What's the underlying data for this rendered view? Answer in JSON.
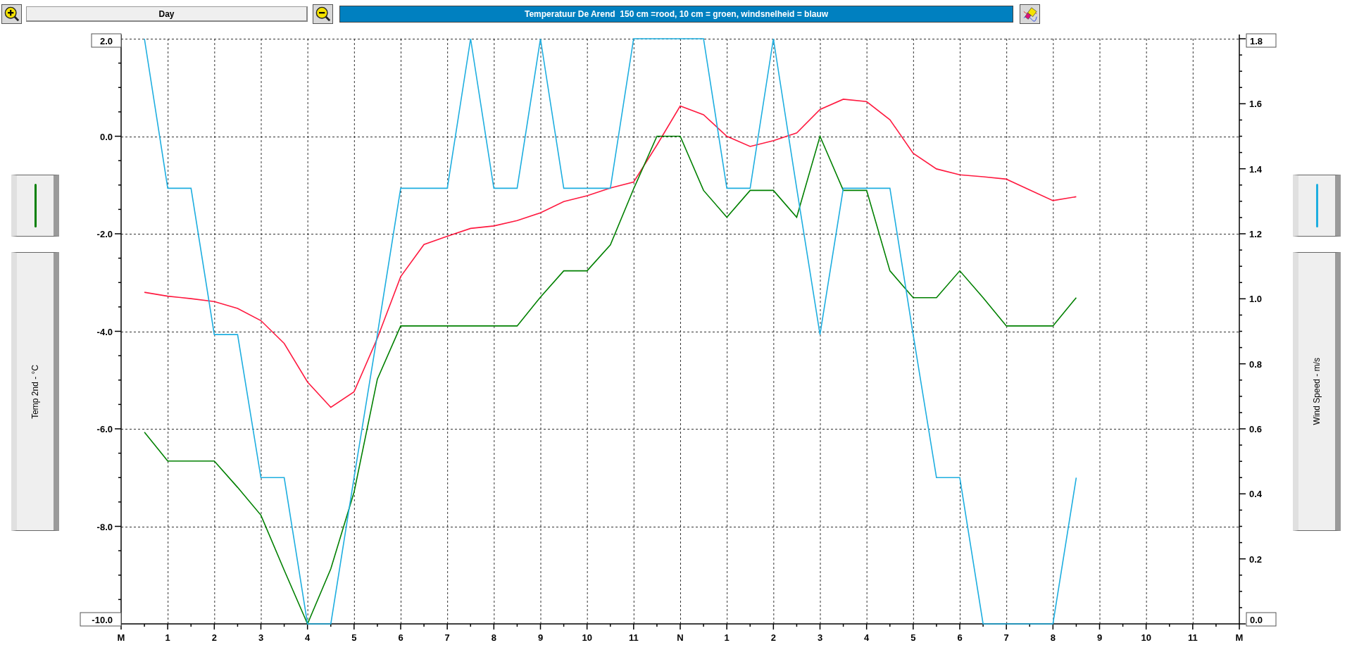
{
  "toolbar": {
    "period_button": "Day",
    "title": "Temperatuur De Arend  150 cm =rood, 10 cm = groen, windsnelheid = blauw"
  },
  "left_panel": {
    "color": "#008000",
    "axis_title": "Temp 2nd - °C"
  },
  "right_panel": {
    "color": "#1eaee0",
    "axis_title": "Wind Speed - m/s"
  },
  "chart": {
    "chart_data": {
      "type": "line",
      "grid": true,
      "categories": [
        "M",
        null,
        "1",
        null,
        "2",
        null,
        "3",
        null,
        "4",
        null,
        "5",
        null,
        "6",
        null,
        "7",
        null,
        "8",
        null,
        "9",
        null,
        "10",
        null,
        "11",
        null,
        "N",
        null,
        "1",
        null,
        "2",
        null,
        "3",
        null,
        "4",
        null,
        "5",
        null,
        "6",
        null,
        "7",
        null,
        "8",
        null,
        "9",
        null,
        "10",
        null,
        "11",
        null,
        "M"
      ],
      "ylim": [
        -10,
        2
      ],
      "yticks": [
        {
          "value": 2,
          "label": "2.0"
        },
        {
          "value": 0,
          "label": "0.0"
        },
        {
          "value": -2,
          "label": "-2.0"
        },
        {
          "value": -4,
          "label": "-4.0"
        },
        {
          "value": -6,
          "label": "-6.0"
        },
        {
          "value": -8,
          "label": "-8.0"
        },
        {
          "value": -10,
          "label": "-10.0"
        }
      ],
      "y2lim": [
        0,
        1.8
      ],
      "y2ticks": [
        {
          "value": 1.8,
          "label": "1.8"
        },
        {
          "value": 1.6,
          "label": "1.6"
        },
        {
          "value": 1.4,
          "label": "1.4"
        },
        {
          "value": 1.2,
          "label": "1.2"
        },
        {
          "value": 1,
          "label": "1.0"
        },
        {
          "value": 0.8,
          "label": "0.8"
        },
        {
          "value": 0.6,
          "label": "0.6"
        },
        {
          "value": 0.4,
          "label": "0.4"
        },
        {
          "value": 0.2,
          "label": "0.2"
        },
        {
          "value": 0,
          "label": "0.0"
        }
      ],
      "series": [
        {
          "color": "#ff1a40",
          "values": [
            null,
            -3.2,
            -3.28,
            -3.33,
            -3.39,
            -3.53,
            -3.78,
            -4.25,
            -5.04,
            -5.56,
            -5.24,
            -4.14,
            -2.88,
            -2.22,
            -2.05,
            -1.89,
            -1.84,
            -1.73,
            -1.57,
            -1.34,
            -1.22,
            -1.06,
            -0.94,
            -0.18,
            0.62,
            0.44,
            0,
            -0.21,
            -0.09,
            0.07,
            0.55,
            0.76,
            0.71,
            0.34,
            -0.35,
            -0.67,
            -0.79,
            -0.83,
            -0.88,
            -1.1,
            -1.32,
            -1.24,
            null,
            null,
            null,
            null,
            null,
            null,
            null
          ]
        },
        {
          "color": "#008000",
          "values": [
            null,
            -6.07,
            -6.66,
            -6.66,
            -6.66,
            -7.2,
            -7.77,
            -8.9,
            -10,
            -8.87,
            -7.3,
            -4.98,
            -3.89,
            -3.89,
            -3.89,
            -3.89,
            -3.89,
            -3.89,
            -3.3,
            -2.76,
            -2.76,
            -2.23,
            -1.08,
            0,
            0,
            -1.11,
            -1.66,
            -1.11,
            -1.11,
            -1.66,
            0,
            -1.11,
            -1.11,
            -2.76,
            -3.31,
            -3.31,
            -2.76,
            -3.31,
            -3.89,
            -3.89,
            -3.89,
            -3.31,
            null,
            null,
            null,
            null,
            null,
            null,
            null
          ]
        },
        {
          "color": "#1eaee0",
          "axis": "y2",
          "values": [
            null,
            1.8,
            1.34,
            1.34,
            0.89,
            0.89,
            0.45,
            0.45,
            0,
            0,
            0.45,
            0.89,
            1.34,
            1.34,
            1.34,
            1.8,
            1.34,
            1.34,
            1.8,
            1.34,
            1.34,
            1.34,
            1.8,
            1.8,
            1.8,
            1.8,
            1.34,
            1.34,
            1.8,
            1.34,
            0.89,
            1.34,
            1.34,
            1.34,
            0.89,
            0.45,
            0.45,
            0,
            0,
            0,
            0,
            0.45,
            null,
            null,
            null,
            null,
            null,
            null,
            null
          ]
        }
      ]
    }
  }
}
